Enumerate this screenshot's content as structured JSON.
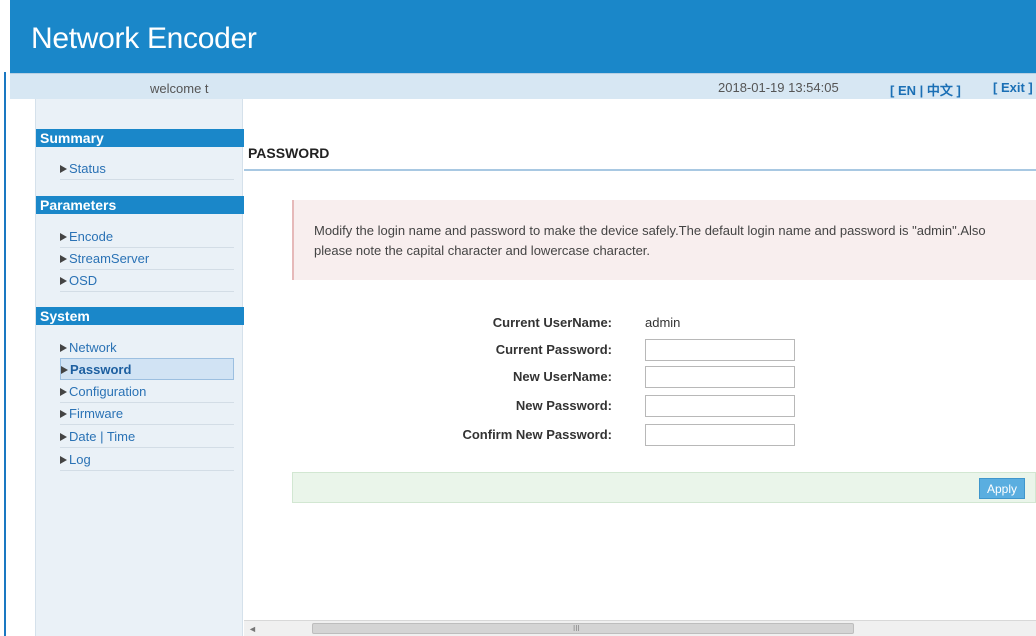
{
  "app": {
    "title": "Network Encoder"
  },
  "topbar": {
    "welcome": "welcome t",
    "datetime": "2018-01-19 13:54:05",
    "lang_open": "[ ",
    "lang_en": "EN",
    "lang_sep": " | ",
    "lang_cn": "中文",
    "lang_close": " ]",
    "exit": "[ Exit ]"
  },
  "sidebar": {
    "sections": [
      {
        "title": "Summary",
        "items": [
          "Status"
        ]
      },
      {
        "title": "Parameters",
        "items": [
          "Encode",
          "StreamServer",
          "OSD"
        ]
      },
      {
        "title": "System",
        "items": [
          "Network",
          "Password",
          "Configuration",
          "Firmware",
          "Date | Time",
          "Log"
        ]
      }
    ],
    "active": "Password"
  },
  "main": {
    "heading": "PASSWORD",
    "alert": "Modify the login name and password to make the device safely.The default login name and password is \"admin\".Also please note the capital character and lowercase character.",
    "form": {
      "current_username_label": "Current UserName:",
      "current_username_value": "admin",
      "current_password_label": "Current Password:",
      "new_username_label": "New UserName:",
      "new_password_label": "New Password:",
      "confirm_password_label": "Confirm New Password:"
    },
    "apply_label": "Apply"
  },
  "scrollbar": {
    "grip": "III"
  },
  "colors": {
    "header": "#1a87c9",
    "accent": "#5aaee0",
    "link": "#1a6fb5"
  }
}
